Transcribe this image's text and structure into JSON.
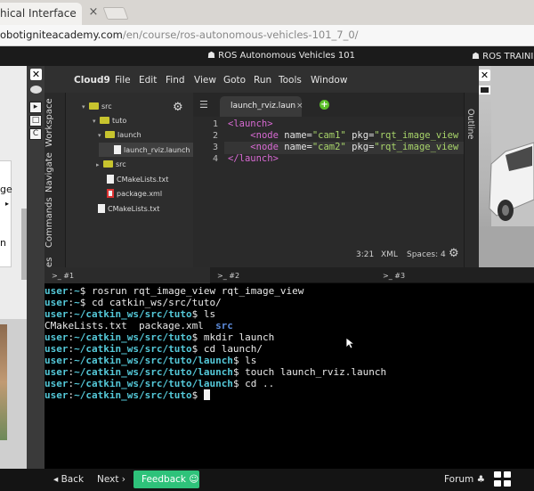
{
  "browser": {
    "tab_title": "hical Interface",
    "tab_close": "×",
    "url_host": "obotigniteacademy.com",
    "url_path": "/en/course/ros-autonomous-vehicles-101_7_0/"
  },
  "course": {
    "title": "☗ ROS Autonomous Vehicles 101",
    "right_title": "☗ ROS TRAININ"
  },
  "controls": {
    "close": "✕",
    "buttons": [
      "▸",
      "□",
      "C"
    ]
  },
  "left_panel": {
    "text_top": "ge",
    "text_mid": "n",
    "small": "▸"
  },
  "c9": {
    "brand": "Cloud9",
    "menu": [
      "File",
      "Edit",
      "Find",
      "View",
      "Goto",
      "Run",
      "Tools",
      "Window"
    ]
  },
  "side_tabs": [
    "Workspace",
    "Navigate",
    "Commands",
    "es"
  ],
  "tree": {
    "gear": "⚙",
    "items": [
      {
        "label": "src",
        "kind": "folder",
        "arrow": "▾"
      },
      {
        "label": "tuto",
        "kind": "folder",
        "arrow": "▾"
      },
      {
        "label": "launch",
        "kind": "folder",
        "arrow": "▾"
      },
      {
        "label": "launch_rviz.launch",
        "kind": "file"
      },
      {
        "label": "src",
        "kind": "folder",
        "arrow": "▸"
      },
      {
        "label": "CMakeLists.txt",
        "kind": "file"
      },
      {
        "label": "package.xml",
        "kind": "xml"
      },
      {
        "label": "CMakeLists.txt",
        "kind": "file"
      }
    ]
  },
  "editor": {
    "tab_label": "launch_rviz.laun",
    "tab_close": "×",
    "plus": "+",
    "toolbar_icon": "☰",
    "line_numbers": [
      "1",
      "2",
      "3",
      "4"
    ],
    "lines": [
      {
        "tag_open": "<launch>",
        "rest": ""
      },
      {
        "indent": "    ",
        "tag_open": "<node ",
        "attr1": "name=",
        "val1": "\"cam1\"",
        "attr2": " pkg=",
        "val2": "\"rqt_image_view"
      },
      {
        "indent": "    ",
        "tag_open": "<node ",
        "attr1": "name=",
        "val1": "\"cam2\"",
        "attr2": " pkg=",
        "val2": "\"rqt_image_view"
      },
      {
        "tag_open": "</launch>",
        "rest": ""
      }
    ],
    "status": {
      "position": "3:21",
      "mode": "XML",
      "spaces": "Spaces: 4",
      "gear": "⚙"
    },
    "outline": "Outline"
  },
  "viewer": {
    "close": "✕"
  },
  "terminal_tabs": [
    ">_ #1",
    ">_ #2",
    ">_ #3"
  ],
  "terminal": {
    "lines": [
      {
        "user": "user",
        "sep": ":",
        "path": "~",
        "cmd": "$ rosrun rqt_image_view rqt_image_view"
      },
      {
        "user": "user",
        "sep": ":",
        "path": "~",
        "cmd": "$ cd catkin_ws/src/tuto/"
      },
      {
        "user": "user",
        "sep": ":",
        "path": "~/catkin_ws/src/tuto",
        "cmd": "$ ls"
      },
      {
        "plain": "CMakeLists.txt  package.xml  ",
        "dir": "src"
      },
      {
        "user": "user",
        "sep": ":",
        "path": "~/catkin_ws/src/tuto",
        "cmd": "$ mkdir launch"
      },
      {
        "user": "user",
        "sep": ":",
        "path": "~/catkin_ws/src/tuto",
        "cmd": "$ cd launch/"
      },
      {
        "user": "user",
        "sep": ":",
        "path": "~/catkin_ws/src/tuto/launch",
        "cmd": "$ ls"
      },
      {
        "user": "user",
        "sep": ":",
        "path": "~/catkin_ws/src/tuto/launch",
        "cmd": "$ touch launch_rviz.launch"
      },
      {
        "user": "user",
        "sep": ":",
        "path": "~/catkin_ws/src/tuto/launch",
        "cmd": "$ cd .."
      },
      {
        "user": "user",
        "sep": ":",
        "path": "~/catkin_ws/src/tuto",
        "cmd": "$ "
      }
    ]
  },
  "bottom": {
    "back": "◂ Back",
    "next": "Next ›",
    "feedback": "Feedback ☺",
    "forum": "Forum ♣"
  }
}
